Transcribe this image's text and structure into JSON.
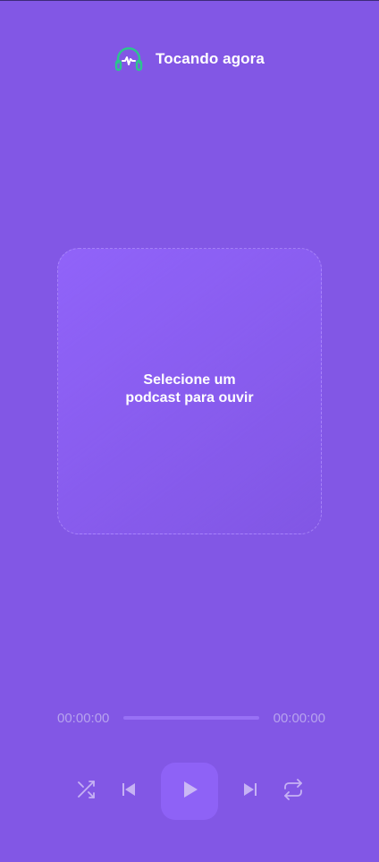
{
  "header": {
    "title": "Tocando agora",
    "logo_icon": "headphones-icon",
    "logo_color": "#2cc58f"
  },
  "empty_state": {
    "line1": "Selecione um",
    "line2": "podcast para ouvir"
  },
  "player": {
    "current_time": "00:00:00",
    "total_time": "00:00:00",
    "progress": 0,
    "controls": [
      {
        "name": "shuffle-icon"
      },
      {
        "name": "previous-icon"
      },
      {
        "name": "play-icon"
      },
      {
        "name": "next-icon"
      },
      {
        "name": "repeat-icon"
      }
    ]
  },
  "colors": {
    "background": "#8257e5",
    "accent": "#2cc58f",
    "muted_icon": "#c6b2f4"
  }
}
